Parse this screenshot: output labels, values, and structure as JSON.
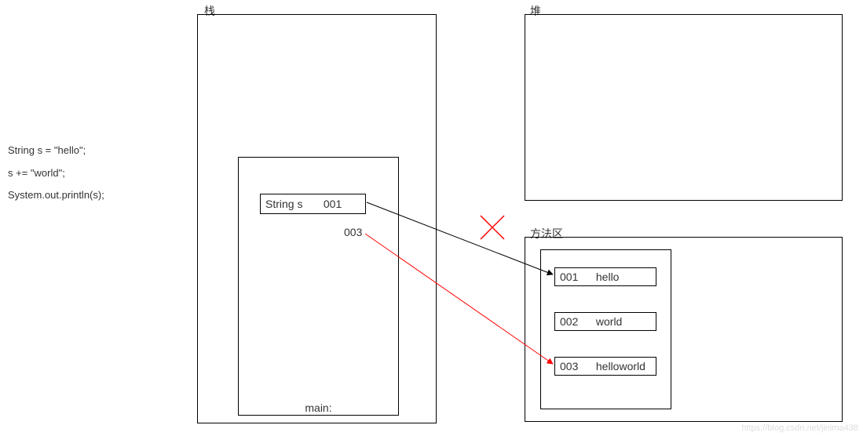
{
  "code": {
    "line1": "String s = \"hello\";",
    "line2": "s += \"world\";",
    "line3": "System.out.println(s);"
  },
  "regions": {
    "stack": "栈",
    "heap": "堆",
    "method_area": "方法区"
  },
  "stack": {
    "frame_label": "main:",
    "var_name": "String s",
    "var_addr_old": "001",
    "var_addr_new": "003"
  },
  "string_pool": {
    "entries": [
      {
        "addr": "001",
        "value": "hello"
      },
      {
        "addr": "002",
        "value": "world"
      },
      {
        "addr": "003",
        "value": "helloworld"
      }
    ]
  },
  "watermark": "https://blog.csdn.net/jinima438",
  "arrow_color_old": "#000000",
  "arrow_color_new": "#ff0000",
  "cross_color": "#ff0000"
}
